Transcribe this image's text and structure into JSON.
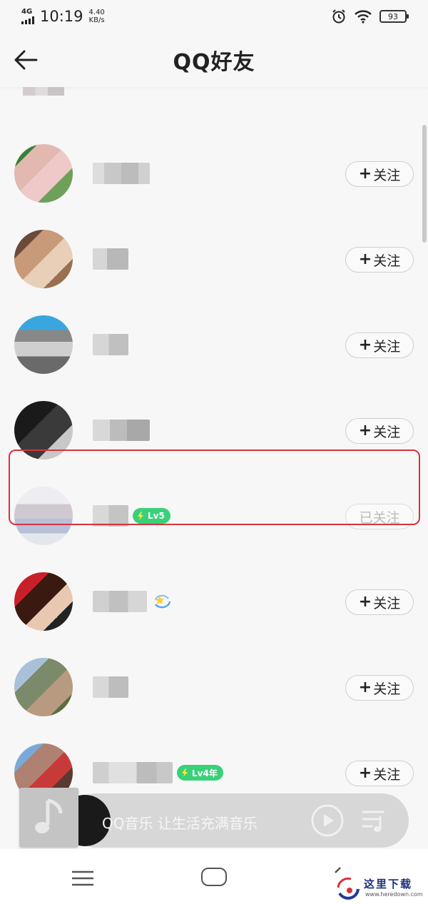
{
  "status_bar": {
    "network": "4G",
    "time": "10:19",
    "speed_value": "4.40",
    "speed_unit": "KB/s",
    "battery": "93",
    "icons": [
      "alarm-icon",
      "wifi-icon",
      "battery-icon"
    ]
  },
  "header": {
    "title": "QQ好友",
    "back_icon": "back-arrow-icon"
  },
  "friends": [
    {
      "name_blurred": true,
      "follow_label": "关注",
      "follow_prefix": "+",
      "followed": false,
      "badge": null
    },
    {
      "name_blurred": true,
      "follow_label": "关注",
      "follow_prefix": "+",
      "followed": false,
      "badge": null
    },
    {
      "name_blurred": true,
      "follow_label": "关注",
      "follow_prefix": "+",
      "followed": false,
      "badge": null
    },
    {
      "name_blurred": true,
      "follow_label": "关注",
      "follow_prefix": "+",
      "followed": false,
      "badge": null
    },
    {
      "name_blurred": true,
      "follow_label": "已关注",
      "follow_prefix": "",
      "followed": true,
      "badge": "Lv5",
      "highlighted": true
    },
    {
      "name_blurred": true,
      "follow_label": "关注",
      "follow_prefix": "+",
      "followed": false,
      "badge": null,
      "emoji": "star-swirl-icon"
    },
    {
      "name_blurred": true,
      "follow_label": "关注",
      "follow_prefix": "+",
      "followed": false,
      "badge": null
    },
    {
      "name_blurred": true,
      "follow_label": "关注",
      "follow_prefix": "+",
      "followed": false,
      "badge": "Lv4年"
    }
  ],
  "music_player": {
    "text": "QQ音乐 让生活充满音乐",
    "icons": [
      "music-note-icon",
      "play-icon",
      "playlist-icon"
    ]
  },
  "nav_bar": {
    "icons": [
      "menu-icon",
      "home-icon",
      "back-icon"
    ]
  },
  "watermark": {
    "text": "这里下载",
    "sub": "www.heredown.com"
  },
  "colors": {
    "accent_green": "#3ad07a",
    "highlight_red": "#d8323c",
    "followed_gray": "#bbbbbb"
  }
}
